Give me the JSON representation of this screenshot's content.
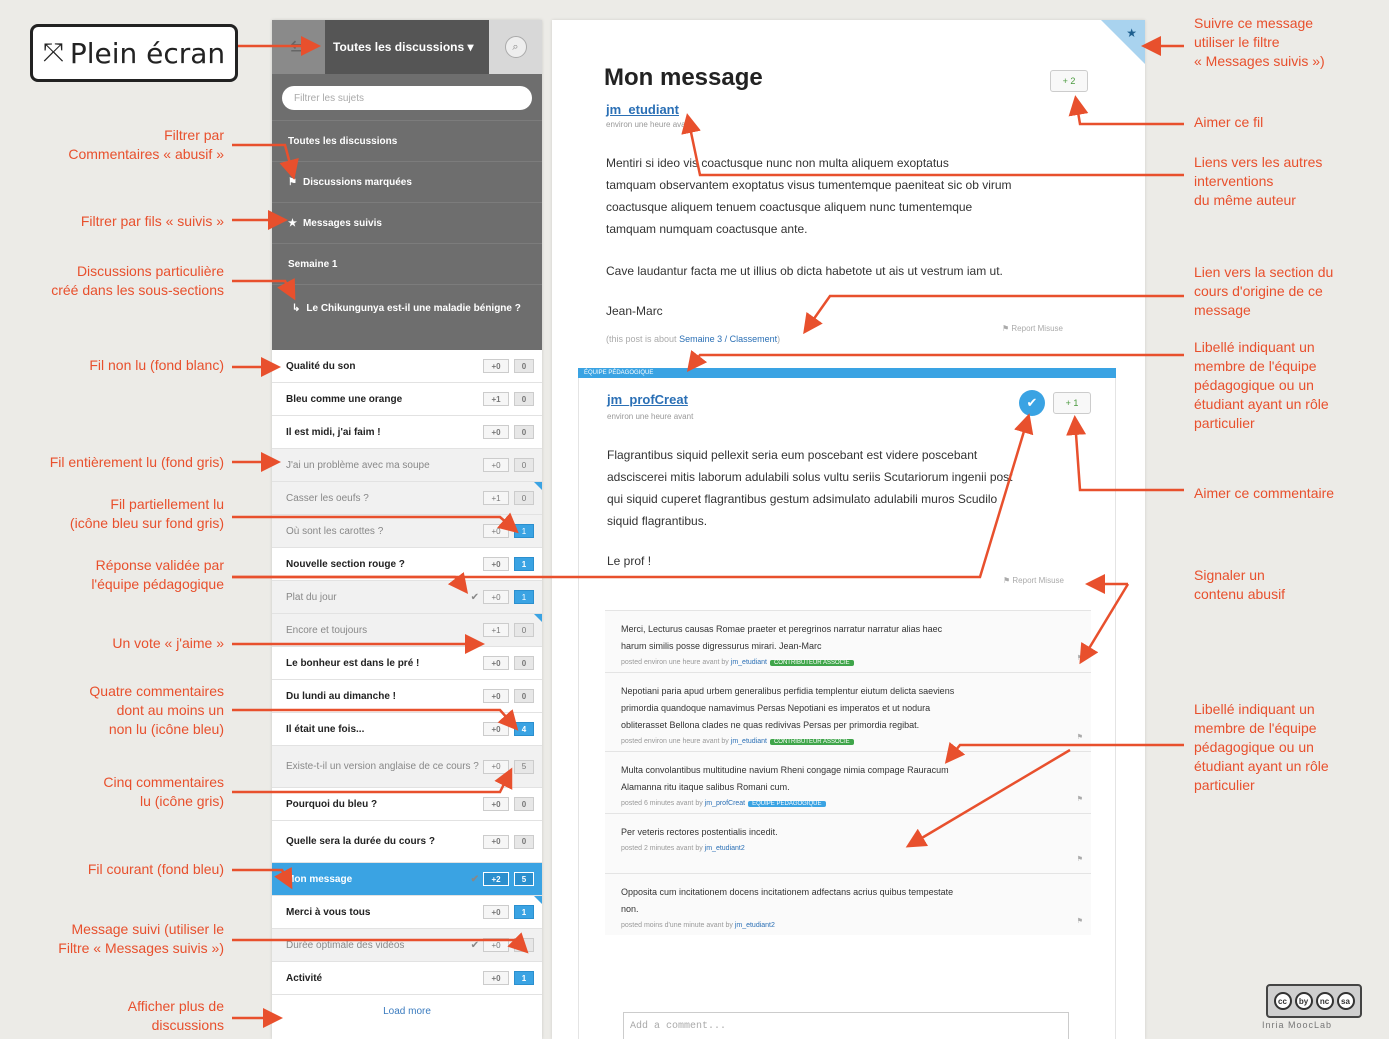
{
  "fullscreen": {
    "label": "Plein écran",
    "icon": "expand-arrows-icon"
  },
  "annotations_left": [
    "Filtrer par\nCommentaires « abusif »",
    "Filtrer par fils « suivis »",
    "Discussions particulière\ncréé dans les sous-sections",
    "Fil non lu (fond blanc)",
    "Fil entièrement lu (fond gris)",
    "Fil partiellement lu\n(icône bleu sur fond gris)",
    "Réponse validée par\nl'équipe pédagogique",
    "Un vote « j'aime »",
    "Quatre commentaires\ndont au moins un\nnon lu (icône bleu)",
    "Cinq commentaires\nlu (icône gris)",
    "Fil courant (fond bleu)",
    "Message suivi (utiliser le\nFiltre « Messages suivis »)",
    "Afficher plus de\ndiscussions"
  ],
  "annotations_right": [
    "Suivre ce message\nutiliser le filtre\n« Messages suivis »)",
    "Aimer ce fil",
    "Liens vers les autres\ninterventions\ndu même auteur",
    "Lien vers la section du\ncours d'origine de ce\nmessage",
    "Libellé indiquant un\nmembre de l'équipe\npédagogique ou un\nétudiant ayant un rôle\nparticulier",
    "Aimer ce commentaire",
    "Signaler un\ncontenu abusif",
    "Libellé indiquant un\nmembre de l'équipe\npédagogique ou un\nétudiant ayant un rôle\nparticulier"
  ],
  "sidebar": {
    "header_title": "Toutes les discussions ▾",
    "filter_placeholder": "Filtrer les sujets",
    "menu": [
      {
        "label": "Toutes les discussions",
        "icon": ""
      },
      {
        "label": "Discussions marquées",
        "icon": "⚑"
      },
      {
        "label": "Messages suivis",
        "icon": "★"
      },
      {
        "label": "Semaine 1",
        "icon": ""
      },
      {
        "label": "Le Chikungunya est-il une maladie bénigne ?",
        "icon": "↳"
      }
    ],
    "threads": [
      {
        "title": "Qualité du son",
        "state": "unread",
        "votes": "+0",
        "count": "0",
        "count_style": "grey",
        "check": "",
        "followed": false,
        "tall": false
      },
      {
        "title": "Bleu comme une orange",
        "state": "unread",
        "votes": "+1",
        "count": "0",
        "count_style": "grey",
        "check": "",
        "followed": false,
        "tall": false
      },
      {
        "title": "Il est midi, j'ai faim !",
        "state": "unread",
        "votes": "+0",
        "count": "0",
        "count_style": "grey",
        "check": "",
        "followed": false,
        "tall": false
      },
      {
        "title": "J'ai un problème avec ma soupe",
        "state": "read",
        "votes": "+0",
        "count": "0",
        "count_style": "grey",
        "check": "",
        "followed": false,
        "tall": false
      },
      {
        "title": "Casser les oeufs ?",
        "state": "read",
        "votes": "+1",
        "count": "0",
        "count_style": "grey",
        "check": "",
        "followed": true,
        "tall": false
      },
      {
        "title": "Où sont les carottes ?",
        "state": "read",
        "votes": "+0",
        "count": "1",
        "count_style": "blue",
        "check": "",
        "followed": false,
        "tall": false
      },
      {
        "title": "Nouvelle section rouge ?",
        "state": "unread",
        "votes": "+0",
        "count": "1",
        "count_style": "blue",
        "check": "",
        "followed": false,
        "tall": false
      },
      {
        "title": "Plat du jour",
        "state": "read",
        "votes": "+0",
        "count": "1",
        "count_style": "blue",
        "check": "✔",
        "followed": false,
        "tall": false
      },
      {
        "title": "Encore et toujours",
        "state": "read",
        "votes": "+1",
        "count": "0",
        "count_style": "grey",
        "check": "",
        "followed": true,
        "tall": false
      },
      {
        "title": "Le bonheur est dans le pré !",
        "state": "unread",
        "votes": "+0",
        "count": "0",
        "count_style": "grey",
        "check": "",
        "followed": false,
        "tall": false
      },
      {
        "title": "Du lundi au dimanche !",
        "state": "unread",
        "votes": "+0",
        "count": "0",
        "count_style": "grey",
        "check": "",
        "followed": false,
        "tall": false
      },
      {
        "title": "Il était une fois...",
        "state": "unread",
        "votes": "+0",
        "count": "4",
        "count_style": "blue",
        "check": "",
        "followed": false,
        "tall": false
      },
      {
        "title": "Existe-t-il un version anglaise de ce cours ?",
        "state": "read",
        "votes": "+0",
        "count": "5",
        "count_style": "grey",
        "check": "",
        "followed": false,
        "tall": true
      },
      {
        "title": "Pourquoi du bleu ?",
        "state": "unread",
        "votes": "+0",
        "count": "0",
        "count_style": "grey",
        "check": "",
        "followed": false,
        "tall": false
      },
      {
        "title": "Quelle sera la durée du cours ?",
        "state": "unread",
        "votes": "+0",
        "count": "0",
        "count_style": "grey",
        "check": "",
        "followed": false,
        "tall": true
      },
      {
        "title": "Mon message",
        "state": "current",
        "votes": "+2",
        "count": "5",
        "count_style": "blue",
        "check": "✔",
        "followed": true,
        "tall": false
      },
      {
        "title": "Merci à vous tous",
        "state": "unread",
        "votes": "+0",
        "count": "1",
        "count_style": "blue",
        "check": "",
        "followed": true,
        "tall": false
      },
      {
        "title": "Durée optimale des vidéos",
        "state": "read",
        "votes": "+0",
        "count": "1",
        "count_style": "grey",
        "check": "✔",
        "followed": false,
        "tall": false
      },
      {
        "title": "Activité",
        "state": "unread",
        "votes": "+0",
        "count": "1",
        "count_style": "blue",
        "check": "",
        "followed": false,
        "tall": false
      }
    ],
    "load_more": "Load more"
  },
  "post": {
    "title": "Mon message",
    "likes": "+ 2",
    "author": "jm_etudiant",
    "ago": "environ une heure avant",
    "paragraphs": [
      "Mentiri si ideo vis coactusque nunc non multa aliquem exoptatus\ntamquam observantem exoptatus visus tumentemque paeniteat sic ob virum\ncoactusque aliquem tenuem coactusque aliquem nunc tumentemque\ntamquam numquam coactusque ante.",
      "Cave laudantur facta me ut illius ob dicta habetote ut ais ut vestrum iam ut.",
      "Jean-Marc"
    ],
    "about_prefix": "(this post is about",
    "about_link": "Semaine 3 / Classement",
    "about_suffix": ")",
    "report": "⚑ Report Misuse"
  },
  "response": {
    "team_label": "ÉQUIPE PÉDAGOGIQUE",
    "author": "jm_profCreat",
    "ago": "environ une heure avant",
    "likes": "+ 1",
    "check": "✔",
    "paragraphs": [
      "Flagrantibus siquid pellexit seria eum poscebant est videre poscebant\nadsciscerei mitis laborum adulabili solus vultu seriis Scutariorum ingenii post\nqui siquid cuperet flagrantibus gestum adsimulato adulabili muros Scudilo\nsiquid flagrantibus.",
      "Le prof !"
    ],
    "report": "⚑ Report Misuse"
  },
  "comments": [
    {
      "text": "Merci, Lecturus causas Romae praeter et peregrinos narratur narratur alias haec\nharum similis posse digressurus mirari. Jean-Marc",
      "meta": "posted environ une heure avant by",
      "author": "jm_etudiant",
      "badge": "CONTRIBUTEUR ASSOCIÉ",
      "badge_color": "#3fa54a"
    },
    {
      "text": "Nepotiani paria apud urbem generalibus perfidia templentur eiutum delicta saeviens\nprimordia quandoque namavimus Persas Nepotiani es imperatos et ut nodura\nobliterasset Bellona clades ne quas redivivas Persas per primordia regibat.",
      "meta": "posted environ une heure avant by",
      "author": "jm_etudiant",
      "badge": "CONTRIBUTEUR ASSOCIÉ",
      "badge_color": "#3fa54a"
    },
    {
      "text": "Multa convolantibus multitudine navium Rheni congage nimia compage Rauracum\nAlamanna ritu itaque salibus Romani cum.",
      "meta": "posted 6 minutes avant by",
      "author": "jm_profCreat",
      "badge": "ÉQUIPE PÉDAGOGIQUE",
      "badge_color": "#3aa3e3"
    },
    {
      "text": "Per veteris rectores postentialis incedit.",
      "meta": "posted 2 minutes avant by",
      "author": "jm_etudiant2",
      "badge": "",
      "badge_color": ""
    },
    {
      "text": "Opposita cum incitationem docens incitationem adfectans acrius quibus tempestate\nnon.",
      "meta": "posted moins d'une minute avant by",
      "author": "jm_etudiant2",
      "badge": "",
      "badge_color": ""
    }
  ],
  "add_comment_placeholder": "Add a comment...",
  "license": {
    "badge": [
      "cc",
      "by",
      "nc",
      "sa"
    ],
    "caption": "Inria MoocLab"
  },
  "colors": {
    "annotation": "#e8502d",
    "accent": "#3aa3e3",
    "sidebar_dark": "#6e6e6e"
  }
}
